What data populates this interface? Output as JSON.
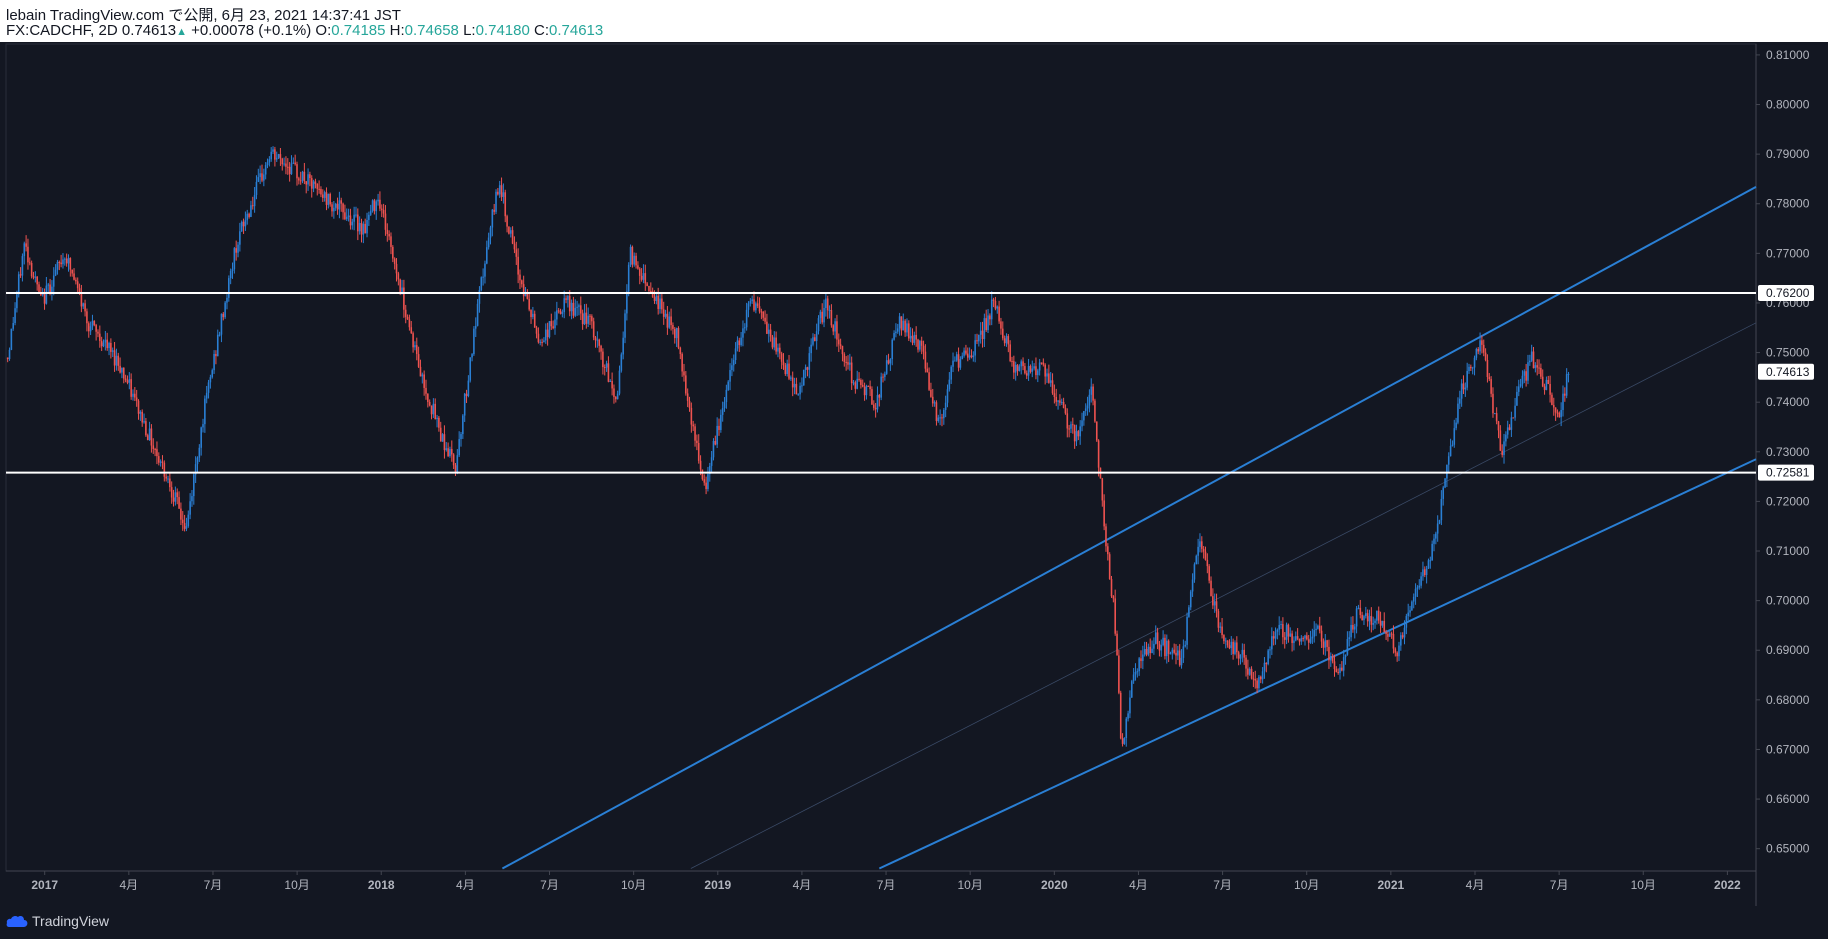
{
  "header": {
    "publisher": "lebain TradingView.com で公開, 6月 23, 2021 14:37:41 JST",
    "symbol": "FX:CADCHF, 2D",
    "last": "0.74613",
    "change": "+0.00078 (+0.1%)",
    "o_label": "O:",
    "o_value": "0.74185",
    "h_label": "H:",
    "h_value": "0.74658",
    "l_label": "L:",
    "l_value": "0.74180",
    "c_label": "C:",
    "c_value": "0.74613",
    "up_arrow": "▲"
  },
  "footer": {
    "brand": "TradingView",
    "logo_icon": "tradingview-logo-icon"
  },
  "colors": {
    "background": "#131722",
    "up": "#2a7fd4",
    "down": "#ef5350",
    "channel": "#2a7fd4",
    "level": "#ffffff",
    "axis_text": "#b2b5be"
  },
  "chart_data": {
    "type": "candlestick",
    "title": "FX:CADCHF, 2D",
    "ylim": [
      0.6455,
      0.8122
    ],
    "yticks": [
      "0.81000",
      "0.80000",
      "0.79000",
      "0.78000",
      "0.77000",
      "0.76000",
      "0.75000",
      "0.74000",
      "0.73000",
      "0.72000",
      "0.71000",
      "0.70000",
      "0.69000",
      "0.68000",
      "0.67000",
      "0.66000",
      "0.65000"
    ],
    "xticks": [
      {
        "label": "2017",
        "t": 2017.0
      },
      {
        "label": "4月",
        "t": 2017.25
      },
      {
        "label": "7月",
        "t": 2017.5
      },
      {
        "label": "10月",
        "t": 2017.75
      },
      {
        "label": "2018",
        "t": 2018.0
      },
      {
        "label": "4月",
        "t": 2018.25
      },
      {
        "label": "7月",
        "t": 2018.5
      },
      {
        "label": "10月",
        "t": 2018.75
      },
      {
        "label": "2019",
        "t": 2019.0
      },
      {
        "label": "4月",
        "t": 2019.25
      },
      {
        "label": "7月",
        "t": 2019.5
      },
      {
        "label": "10月",
        "t": 2019.75
      },
      {
        "label": "2020",
        "t": 2020.0
      },
      {
        "label": "4月",
        "t": 2020.25
      },
      {
        "label": "7月",
        "t": 2020.5
      },
      {
        "label": "10月",
        "t": 2020.75
      },
      {
        "label": "2021",
        "t": 2021.0
      },
      {
        "label": "4月",
        "t": 2021.25
      },
      {
        "label": "7月",
        "t": 2021.5
      },
      {
        "label": "10月",
        "t": 2021.75
      },
      {
        "label": "2022",
        "t": 2022.0
      }
    ],
    "xlim": [
      2016.885,
      2022.085
    ],
    "price_path": [
      [
        2016.89,
        0.749
      ],
      [
        2016.94,
        0.772
      ],
      [
        2016.99,
        0.76
      ],
      [
        2017.06,
        0.77
      ],
      [
        2017.13,
        0.756
      ],
      [
        2017.22,
        0.748
      ],
      [
        2017.3,
        0.735
      ],
      [
        2017.37,
        0.724
      ],
      [
        2017.42,
        0.714
      ],
      [
        2017.47,
        0.737
      ],
      [
        2017.57,
        0.772
      ],
      [
        2017.67,
        0.79
      ],
      [
        2017.72,
        0.788
      ],
      [
        2017.82,
        0.782
      ],
      [
        2017.95,
        0.775
      ],
      [
        2017.99,
        0.782
      ],
      [
        2018.04,
        0.768
      ],
      [
        2018.12,
        0.745
      ],
      [
        2018.18,
        0.733
      ],
      [
        2018.22,
        0.727
      ],
      [
        2018.3,
        0.765
      ],
      [
        2018.35,
        0.785
      ],
      [
        2018.4,
        0.768
      ],
      [
        2018.47,
        0.752
      ],
      [
        2018.55,
        0.76
      ],
      [
        2018.62,
        0.756
      ],
      [
        2018.7,
        0.74
      ],
      [
        2018.74,
        0.77
      ],
      [
        2018.8,
        0.763
      ],
      [
        2018.88,
        0.753
      ],
      [
        2018.96,
        0.722
      ],
      [
        2019.05,
        0.75
      ],
      [
        2019.1,
        0.761
      ],
      [
        2019.17,
        0.751
      ],
      [
        2019.24,
        0.742
      ],
      [
        2019.32,
        0.76
      ],
      [
        2019.4,
        0.745
      ],
      [
        2019.47,
        0.74
      ],
      [
        2019.54,
        0.756
      ],
      [
        2019.6,
        0.752
      ],
      [
        2019.66,
        0.735
      ],
      [
        2019.7,
        0.748
      ],
      [
        2019.76,
        0.75
      ],
      [
        2019.82,
        0.76
      ],
      [
        2019.88,
        0.747
      ],
      [
        2019.96,
        0.747
      ],
      [
        2020.07,
        0.732
      ],
      [
        2020.11,
        0.744
      ],
      [
        2020.15,
        0.714
      ],
      [
        2020.18,
        0.696
      ],
      [
        2020.2,
        0.67
      ],
      [
        2020.24,
        0.686
      ],
      [
        2020.3,
        0.692
      ],
      [
        2020.38,
        0.688
      ],
      [
        2020.43,
        0.713
      ],
      [
        2020.5,
        0.692
      ],
      [
        2020.56,
        0.689
      ],
      [
        2020.6,
        0.682
      ],
      [
        2020.66,
        0.695
      ],
      [
        2020.72,
        0.692
      ],
      [
        2020.79,
        0.694
      ],
      [
        2020.84,
        0.684
      ],
      [
        2020.9,
        0.698
      ],
      [
        2020.97,
        0.696
      ],
      [
        2021.02,
        0.69
      ],
      [
        2021.08,
        0.702
      ],
      [
        2021.13,
        0.712
      ],
      [
        2021.18,
        0.732
      ],
      [
        2021.21,
        0.742
      ],
      [
        2021.27,
        0.752
      ],
      [
        2021.3,
        0.74
      ],
      [
        2021.33,
        0.729
      ],
      [
        2021.38,
        0.742
      ],
      [
        2021.42,
        0.749
      ],
      [
        2021.47,
        0.742
      ],
      [
        2021.5,
        0.738
      ],
      [
        2021.53,
        0.746
      ]
    ],
    "horizontal_levels": [
      0.762,
      0.72581
    ],
    "price_labels": [
      {
        "value": 0.762,
        "text": "0.76200"
      },
      {
        "value": 0.74613,
        "text": "0.74613"
      },
      {
        "value": 0.72581,
        "text": "0.72581"
      }
    ],
    "channel_lines": [
      {
        "p1": [
          2018.36,
          0.646
        ],
        "p2": [
          2022.085,
          0.7834
        ],
        "style": "solid"
      },
      {
        "p1": [
          2019.48,
          0.646
        ],
        "p2": [
          2022.085,
          0.7285
        ],
        "style": "solid"
      },
      {
        "p1": [
          2018.92,
          0.646
        ],
        "p2": [
          2022.085,
          0.756
        ],
        "style": "thin"
      }
    ],
    "grid": false,
    "legend": "none"
  }
}
